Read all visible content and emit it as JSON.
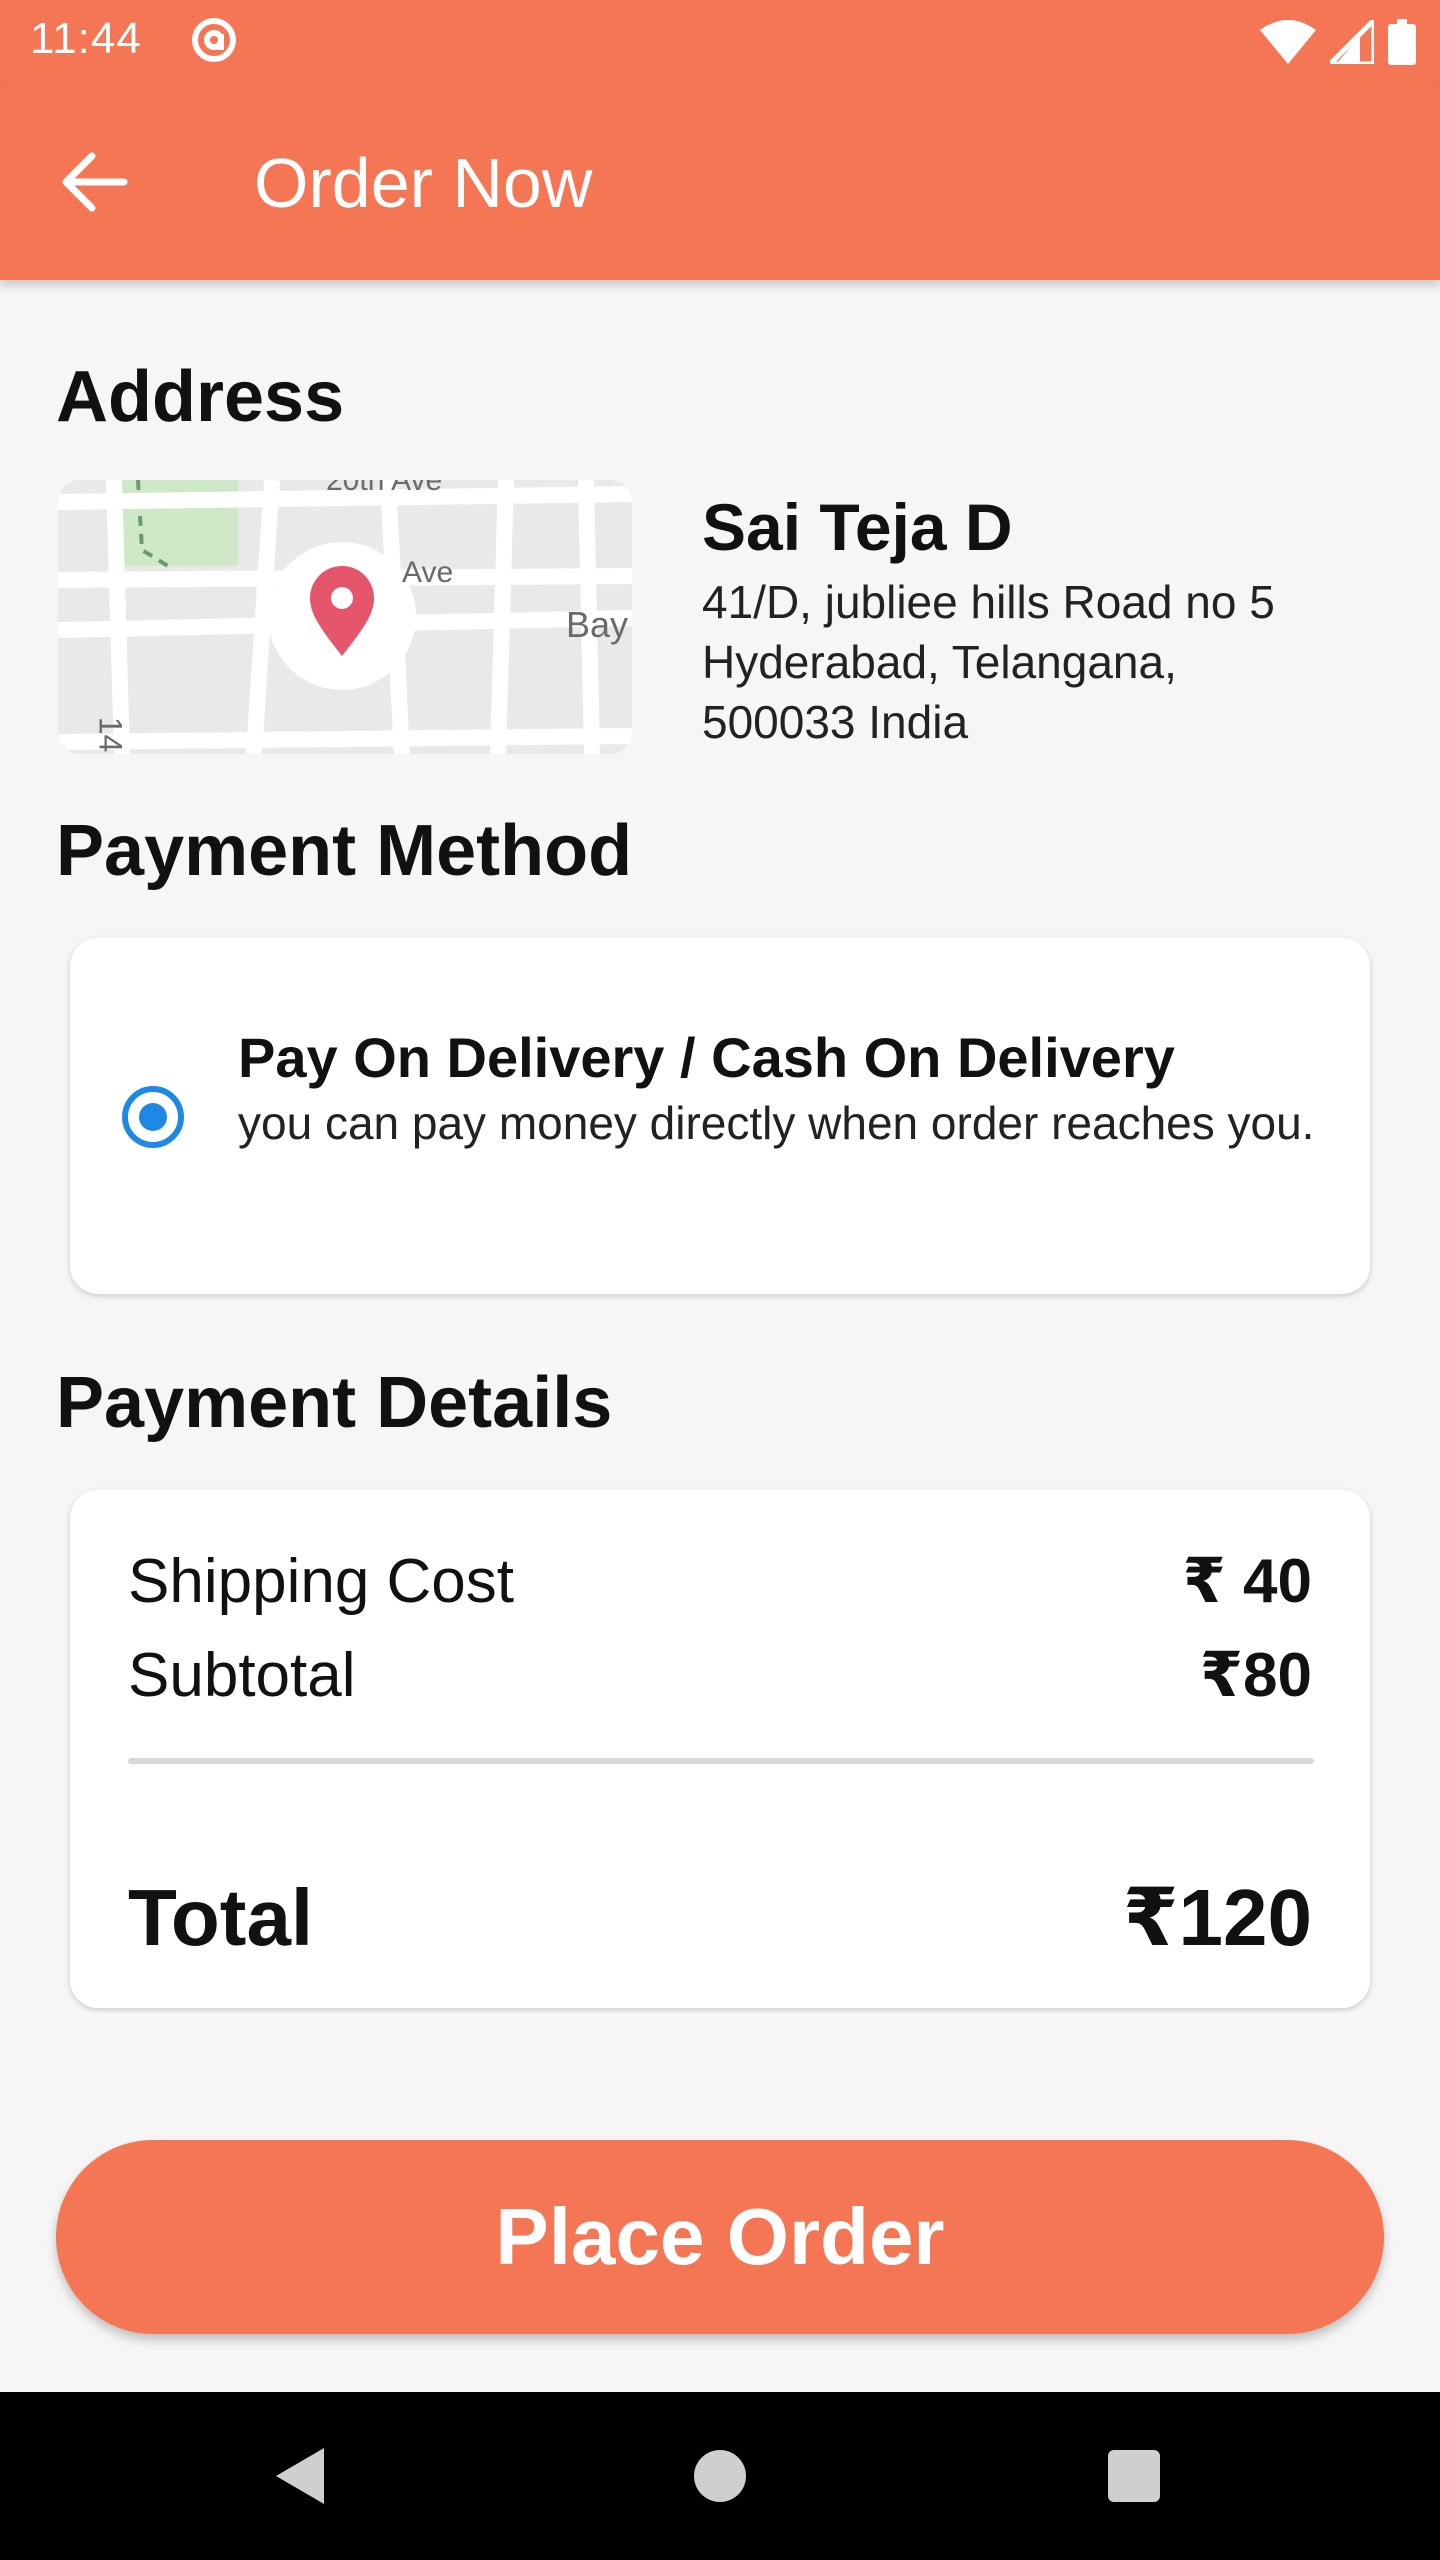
{
  "status_bar": {
    "time": "11:44"
  },
  "app_bar": {
    "title": "Order Now",
    "back_icon": "arrow-left-icon"
  },
  "address": {
    "heading": "Address",
    "name": "Sai Teja D",
    "line1": "41/D, jubliee hills Road no 5",
    "line2": "Hyderabad, Telangana,",
    "line3": "500033 India",
    "map_labels": [
      "20th Ave",
      "Ave",
      "Bay",
      "14"
    ]
  },
  "payment_method": {
    "heading": "Payment Method",
    "option_title": "Pay On Delivery / Cash On Delivery",
    "option_desc": "you can pay money directly when order reaches you.",
    "selected": true
  },
  "payment_details": {
    "heading": "Payment Details",
    "shipping_label": "Shipping Cost",
    "shipping_value": "₹ 40",
    "subtotal_label": "Subtotal",
    "subtotal_value": "₹80",
    "total_label": "Total",
    "total_value": "₹120"
  },
  "actions": {
    "place_order": "Place Order"
  },
  "colors": {
    "accent": "#f47654",
    "radio": "#1e88e5"
  }
}
